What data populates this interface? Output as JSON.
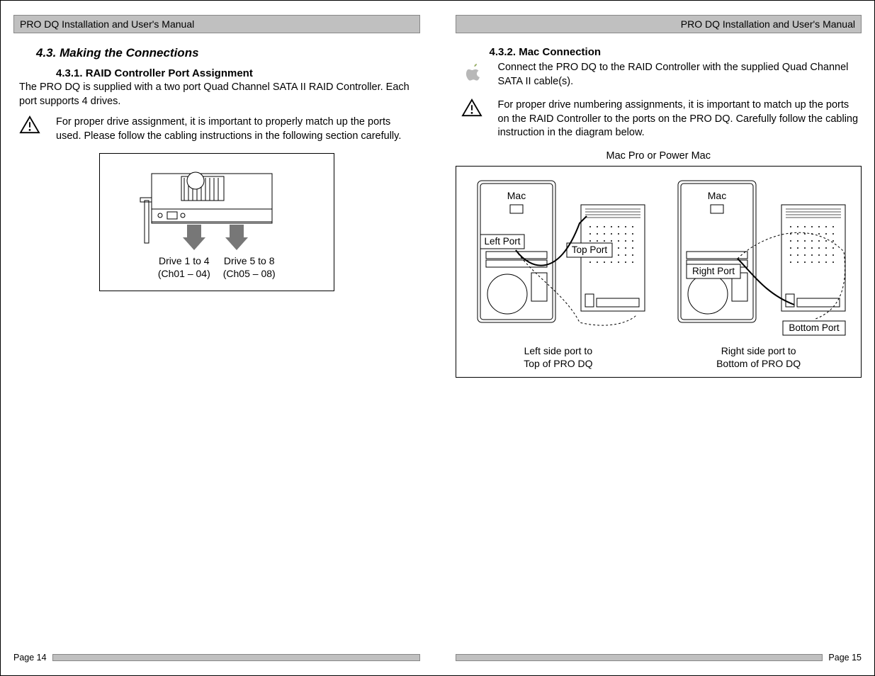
{
  "left": {
    "header": "PRO DQ Installation and User's Manual",
    "h43": "4.3.      Making the Connections",
    "h431": "4.3.1. RAID Controller Port Assignment",
    "intro": "The PRO DQ is supplied with a two port Quad Channel SATA II RAID Controller.  Each port supports 4 drives.",
    "warn": "For proper drive assignment, it is important to properly match up the ports used.  Please follow the cabling instructions in the following section carefully.",
    "figure": {
      "drive1_line1": "Drive 1 to 4",
      "drive1_line2": "(Ch01 – 04)",
      "drive2_line1": "Drive 5 to 8",
      "drive2_line2": "(Ch05 – 08)"
    },
    "page_label": "Page 14"
  },
  "right": {
    "header": "PRO DQ Installation and User's Manual",
    "h432": "4.3.2. Mac Connection",
    "intro": "Connect the PRO DQ to the RAID Controller with the supplied Quad Channel SATA II cable(s).",
    "warn": "For proper drive numbering assignments, it is important to match up the ports on the RAID Controller to the ports on the PRO DQ.  Carefully follow the cabling instruction in the diagram below.",
    "diagram": {
      "title": "Mac Pro or Power Mac",
      "mac_label": "Mac",
      "left_port": "Left Port",
      "top_port": "Top Port",
      "right_port": "Right  Port",
      "bottom_port": "Bottom  Port",
      "caption_left_1": "Left side port to",
      "caption_left_2": "Top of PRO DQ",
      "caption_right_1": "Right side port to",
      "caption_right_2": "Bottom of PRO DQ"
    },
    "page_label": "Page 15"
  },
  "icons": {
    "warning": "warning-icon",
    "apple": "apple-icon"
  }
}
